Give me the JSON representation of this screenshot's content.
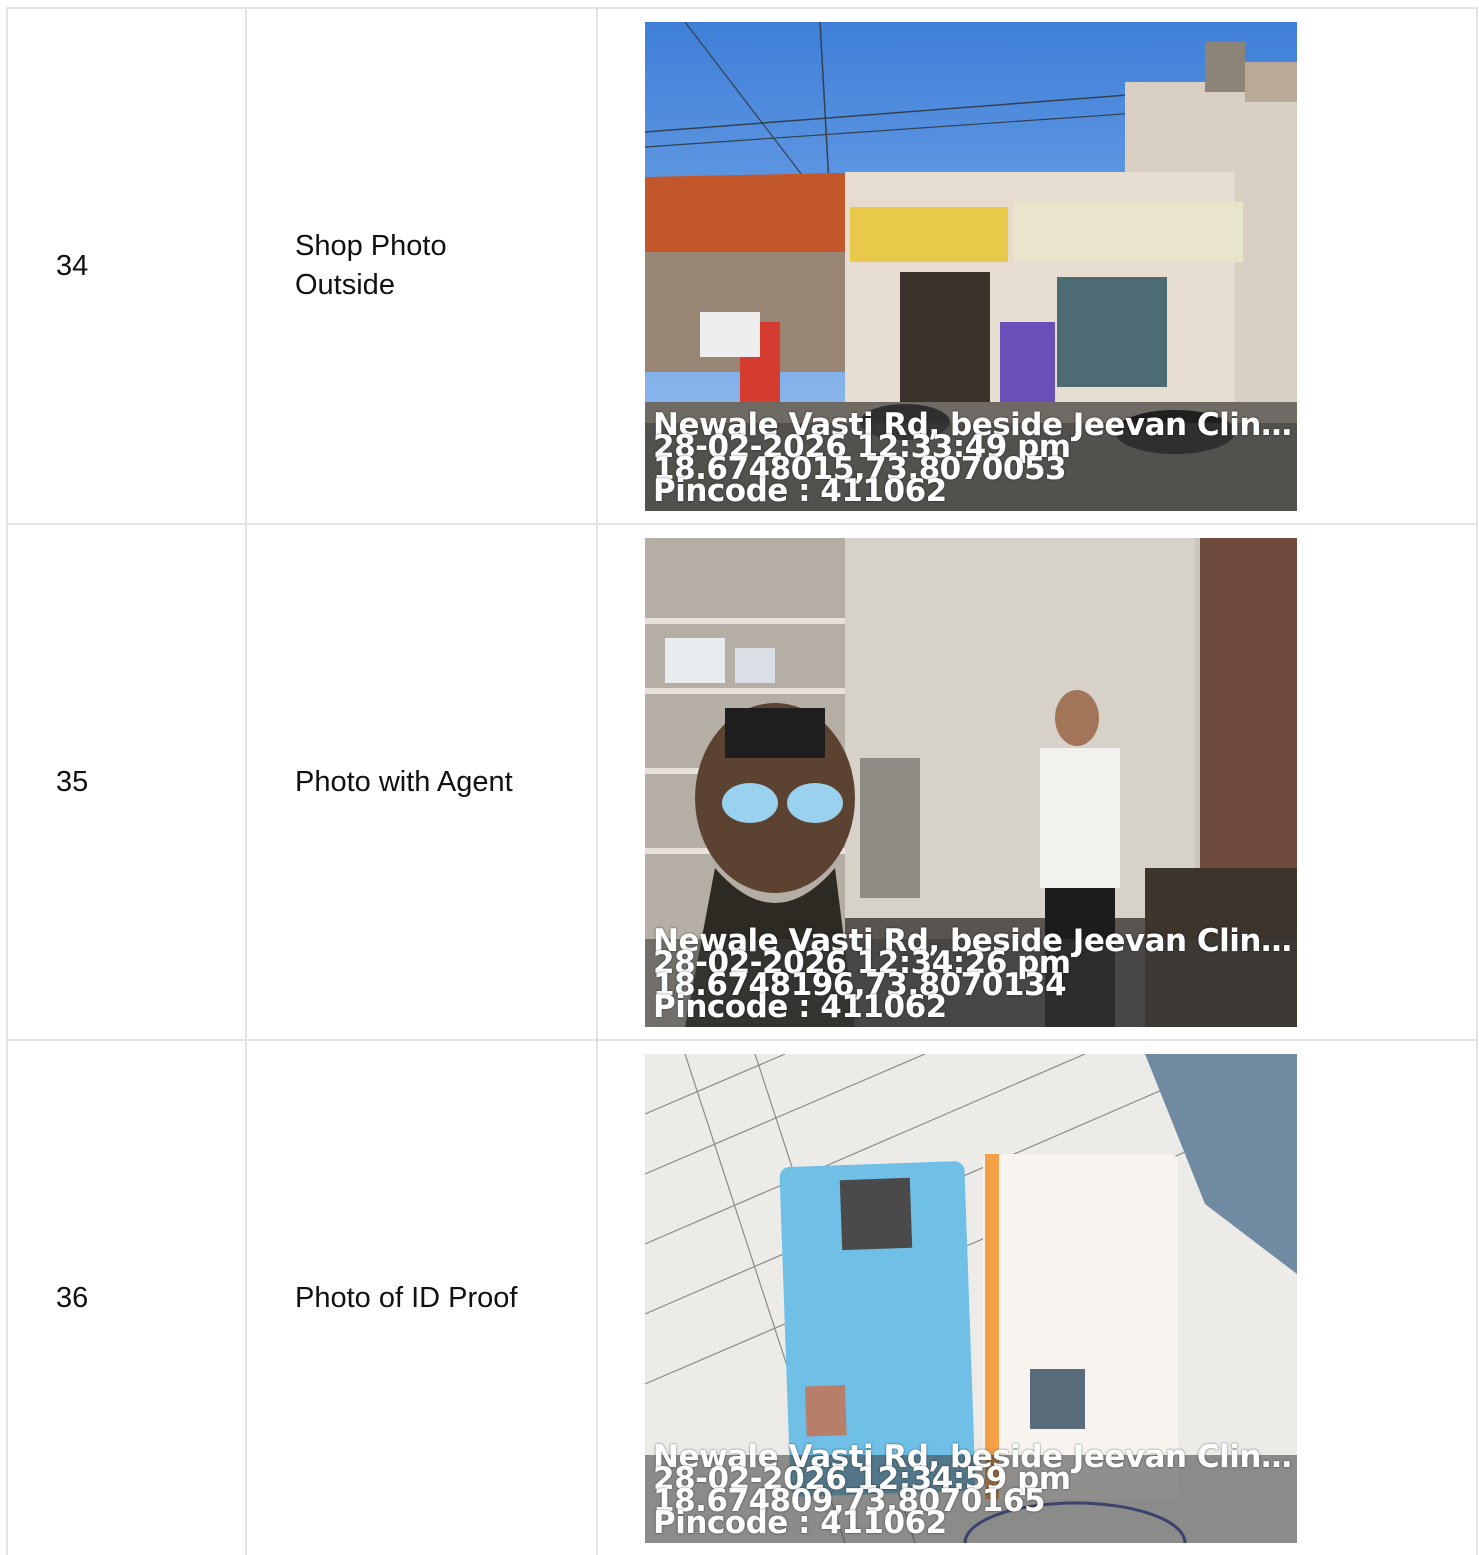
{
  "rows": [
    {
      "number": "34",
      "label": "Shop Photo Outside",
      "photo": {
        "subject": "shop-exterior-photo",
        "address": "Newale Vasti Rd, beside Jeevan Clinic, ...",
        "datetime": "28-02-2026 12:33:49 pm",
        "coordinates": "18.6748015,73.8070053",
        "pincode": "Pincode : 411062"
      }
    },
    {
      "number": "35",
      "label": "Photo with Agent",
      "photo": {
        "subject": "selfie-with-agent-photo",
        "address": "Newale Vasti Rd, beside Jeevan Clinic, ...",
        "datetime": "28-02-2026 12:34:26 pm",
        "coordinates": "18.6748196,73.8070134",
        "pincode": "Pincode : 411062"
      }
    },
    {
      "number": "36",
      "label": "Photo of ID Proof",
      "photo": {
        "subject": "id-cards-photo",
        "address": "Newale Vasti Rd, beside Jeevan Clinic, ...",
        "datetime": "28-02-2026 12:34:59 pm",
        "coordinates": "18.674809,73.8070165",
        "pincode": "Pincode : 411062"
      }
    }
  ]
}
